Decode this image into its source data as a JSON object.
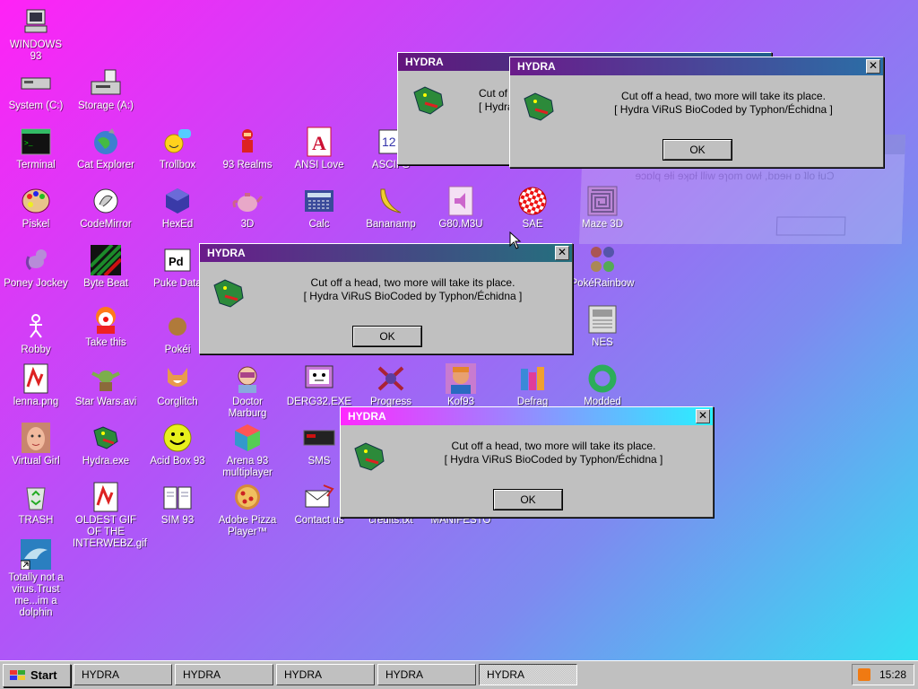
{
  "desktop": {
    "icons": [
      {
        "label": "WINDOWS 93",
        "icon": "computer-icon"
      },
      {
        "label": "System (C:)",
        "icon": "drive-icon"
      },
      {
        "label": "Storage (A:)",
        "icon": "floppy-drive-icon"
      },
      {
        "label": "Terminal",
        "icon": "terminal-icon"
      },
      {
        "label": "Cat Explorer",
        "icon": "cat-globe-icon"
      },
      {
        "label": "Trollbox",
        "icon": "chat-smiley-icon"
      },
      {
        "label": "93 Realms",
        "icon": "realms-icon"
      },
      {
        "label": "ANSI Love",
        "icon": "ansi-book-icon"
      },
      {
        "label": "ASCII G",
        "icon": "ascii-icon"
      },
      {
        "label": "Piskel",
        "icon": "palette-icon"
      },
      {
        "label": "CodeMirror",
        "icon": "codemirror-icon"
      },
      {
        "label": "HexEd",
        "icon": "hex-cube-icon"
      },
      {
        "label": "3D",
        "icon": "teapot-icon"
      },
      {
        "label": "Calc",
        "icon": "calculator-icon"
      },
      {
        "label": "Bananamp",
        "icon": "banana-icon"
      },
      {
        "label": "G80.M3U",
        "icon": "playlist-icon"
      },
      {
        "label": "SAE",
        "icon": "boing-ball-icon"
      },
      {
        "label": "Maze 3D",
        "icon": "maze-icon"
      },
      {
        "label": "Poney Jockey",
        "icon": "pony-icon"
      },
      {
        "label": "Byte Beat",
        "icon": "bytebeat-icon"
      },
      {
        "label": "Puke Data",
        "icon": "pd-icon"
      },
      {
        "label": "PokéRainbow",
        "icon": "pokerainbow-icon"
      },
      {
        "label": "Robby",
        "icon": "stickman-icon"
      },
      {
        "label": "Take this",
        "icon": "clown-icon"
      },
      {
        "label": "Pokéi",
        "icon": "cookie-icon"
      },
      {
        "label": "NES",
        "icon": "nes-icon"
      },
      {
        "label": "lenna.png",
        "icon": "image-file-icon"
      },
      {
        "label": "Star Wars.avi",
        "icon": "yoda-icon"
      },
      {
        "label": "Corglitch",
        "icon": "corgi-icon"
      },
      {
        "label": "Doctor Marburg",
        "icon": "doctor-icon"
      },
      {
        "label": "DERG32.EXE",
        "icon": "monitor-face-icon"
      },
      {
        "label": "Progress",
        "icon": "crossed-swords-icon"
      },
      {
        "label": "Kof93",
        "icon": "fighter-icon"
      },
      {
        "label": "Defrag",
        "icon": "defrag-icon"
      },
      {
        "label": "Modded",
        "icon": "ring-icon"
      },
      {
        "label": "Virtual Girl",
        "icon": "face-icon"
      },
      {
        "label": "Hydra.exe",
        "icon": "hydra-icon"
      },
      {
        "label": "Acid Box 93",
        "icon": "acid-smiley-icon"
      },
      {
        "label": "Arena 93 multiplayer",
        "icon": "cube-icon"
      },
      {
        "label": "SMS",
        "icon": "console-icon"
      },
      {
        "label": "TRASH",
        "icon": "recycle-bin-icon"
      },
      {
        "label": "OLDEST GIF OF THE INTERWEBZ.gif",
        "icon": "gif-file-icon"
      },
      {
        "label": "SIM 93",
        "icon": "book-icon"
      },
      {
        "label": "Adobe Pizza Player™",
        "icon": "pizza-icon"
      },
      {
        "label": "Contact us",
        "icon": "envelope-icon"
      },
      {
        "label": "credits.txt",
        "icon": "text-file-icon"
      },
      {
        "label": "MANIFESTO",
        "icon": "manifesto-icon"
      },
      {
        "label": "Totally not a virus.Trust me...im a dolphin",
        "icon": "dolphin-icon"
      }
    ]
  },
  "dialogs": [
    {
      "title": "HYDRA",
      "line1": "Cut off a head, two more will take its place.",
      "line2": "[ Hydra ViRuS BioCoded by Typhon/Échidna ]",
      "ok": "OK"
    },
    {
      "title": "HYDRA",
      "line1": "Cut off a head, two more will take its place.",
      "line2": "[ Hydra ViRuS BioCoded by Typhon/Échidna ]",
      "ok": "OK"
    },
    {
      "title": "HYDRA",
      "line1": "Cut off a head, two more will take its place.",
      "line2": "[ Hydra ViRuS BioCoded by Typhon/Échidna ]",
      "ok": "OK"
    },
    {
      "title": "HYDRA",
      "line1": "Cut off a head, two more will take its place.",
      "line2": "[ Hydra ViRuS BioCoded by Typhon/Échidna ]",
      "ok": "OK"
    },
    {
      "title": "HYDRA",
      "line1": "Cut off a head, two more will take its place.",
      "line2": "[ Hydra ViRuS BioCoded by Typhon/Échidna ]",
      "ok": "OK"
    }
  ],
  "partial_dialog": {
    "title": "HYDRA",
    "line1_fragment": "Cut of",
    "line2_fragment": "[ Hydra"
  },
  "taskbar": {
    "start_label": "Start",
    "tasks": [
      "HYDRA",
      "HYDRA",
      "HYDRA",
      "HYDRA",
      "HYDRA"
    ],
    "active_task": 4,
    "clock": "15:28",
    "tray_icon": "rss-icon"
  },
  "colors": {
    "desktop_gradient": [
      "#ff22f6",
      "#b055f8",
      "#2fe6f2"
    ],
    "window_face": "#c0c0c0"
  }
}
